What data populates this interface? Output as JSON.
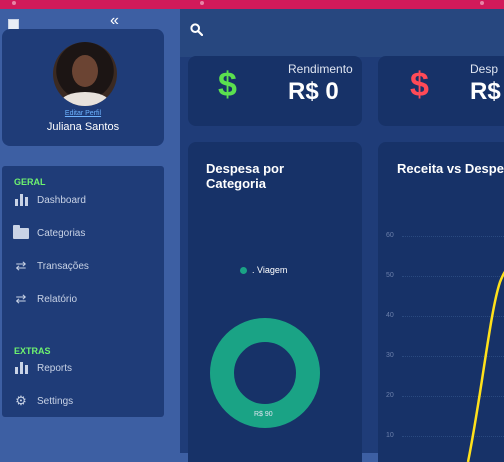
{
  "sidebar": {
    "collapse_icon": "double-chevron-left-icon",
    "profile": {
      "edit_link": "Editar Perfil",
      "name": "Juliana Santos"
    },
    "sections": [
      {
        "title": "GERAL",
        "items": [
          {
            "label": "Dashboard",
            "icon": "bar-chart-icon"
          },
          {
            "label": "Categorias",
            "icon": "folder-icon"
          },
          {
            "label": "Transações",
            "icon": "transfer-icon"
          },
          {
            "label": "Relatório",
            "icon": "transfer-icon"
          }
        ]
      },
      {
        "title": "EXTRAS",
        "items": [
          {
            "label": "Reports",
            "icon": "bar-chart-icon"
          },
          {
            "label": "Settings",
            "icon": "gear-icon"
          }
        ]
      }
    ]
  },
  "header": {
    "search_icon": "search-icon"
  },
  "stats": [
    {
      "symbol": "$",
      "title": "Rendimento",
      "value": "R$ 0",
      "color": "#5be04f"
    },
    {
      "symbol": "$",
      "title": "Desp",
      "value": "R$",
      "color": "#ff4a57"
    }
  ],
  "panels": {
    "category": {
      "title_line1": "Despesa por",
      "title_line2": "Categoria",
      "legend_label": ". Viagem",
      "slice_label": "R$ 90"
    },
    "income_vs_expense": {
      "title": "Receita vs Despe"
    }
  },
  "chart_data": [
    {
      "type": "pie",
      "title": "Despesa por Categoria",
      "categories": [
        "Viagem"
      ],
      "values": [
        90
      ],
      "colors": [
        "#1aa385"
      ],
      "legend": "top"
    },
    {
      "type": "line",
      "title": "Receita vs Despe",
      "yticks": [
        10,
        20,
        30,
        40,
        50,
        60
      ],
      "series_color": "#ffe11a"
    }
  ]
}
